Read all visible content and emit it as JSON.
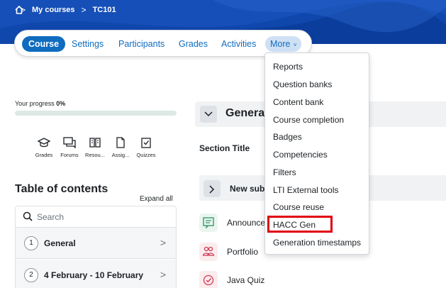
{
  "breadcrumb": {
    "home_icon": "home-icon",
    "items": [
      "My courses",
      "TC101"
    ]
  },
  "nav": {
    "course": "Course",
    "settings": "Settings",
    "participants": "Participants",
    "grades": "Grades",
    "activities": "Activities",
    "more": "More"
  },
  "more_menu": {
    "items": [
      "Reports",
      "Question banks",
      "Content bank",
      "Course completion",
      "Badges",
      "Competencies",
      "Filters",
      "LTI External tools",
      "Course reuse",
      "HACC Gen",
      "Generation timestamps"
    ],
    "highlighted": "HACC Gen",
    "highlight_color": "#e0000f"
  },
  "progress": {
    "label": "Your progress",
    "value": "0%"
  },
  "activity_links": [
    {
      "label": "Grades",
      "icon": "mortarboard-icon"
    },
    {
      "label": "Forums",
      "icon": "forum-icon"
    },
    {
      "label": "Resou...",
      "icon": "resources-icon"
    },
    {
      "label": "Assig...",
      "icon": "assignment-icon"
    },
    {
      "label": "Quizzes",
      "icon": "quiz-icon"
    }
  ],
  "toc": {
    "title": "Table of contents",
    "expand_all": "Expand all",
    "search_placeholder": "Search",
    "sections": [
      {
        "num": "1",
        "label": "General"
      },
      {
        "num": "2",
        "label": "4 February - 10 February"
      }
    ]
  },
  "main": {
    "section_name": "General",
    "section_title_label": "Section Title",
    "subsection_label": "New sub",
    "activities": [
      {
        "label": "Announce",
        "icon": "announcement-icon",
        "color": "#eaf5f0"
      },
      {
        "label": "Portfolio",
        "icon": "portfolio-icon",
        "color": "#fbecee"
      },
      {
        "label": "Java Quiz",
        "icon": "quiz-check-icon",
        "color": "#fbecee"
      }
    ]
  },
  "colors": {
    "banner": "#0f47ad",
    "primary": "#0f6cbf"
  }
}
